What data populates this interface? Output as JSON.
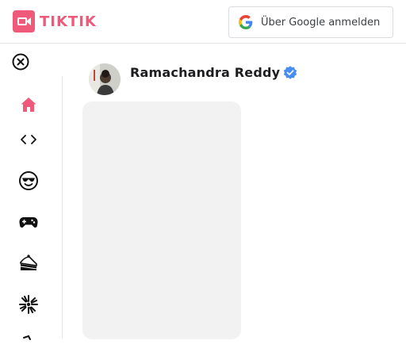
{
  "app": {
    "logo_text": "TIKTIK"
  },
  "header": {
    "google_button_label": "Über Google anmelden"
  },
  "sidebar": {
    "items": [
      {
        "name": "home",
        "icon": "home-icon"
      },
      {
        "name": "coding",
        "icon": "code-icon"
      },
      {
        "name": "comedy",
        "icon": "cool-face-icon"
      },
      {
        "name": "gaming",
        "icon": "gamepad-icon"
      },
      {
        "name": "food",
        "icon": "cake-icon"
      },
      {
        "name": "dance",
        "icon": "sparkle-burst-icon"
      },
      {
        "name": "more",
        "icon": "more-icon"
      }
    ]
  },
  "post": {
    "username": "Ramachandra Reddy",
    "verified": true
  },
  "colors": {
    "brand": "#ef5a7a",
    "verified": "#4a8df0",
    "icon": "#111111"
  }
}
